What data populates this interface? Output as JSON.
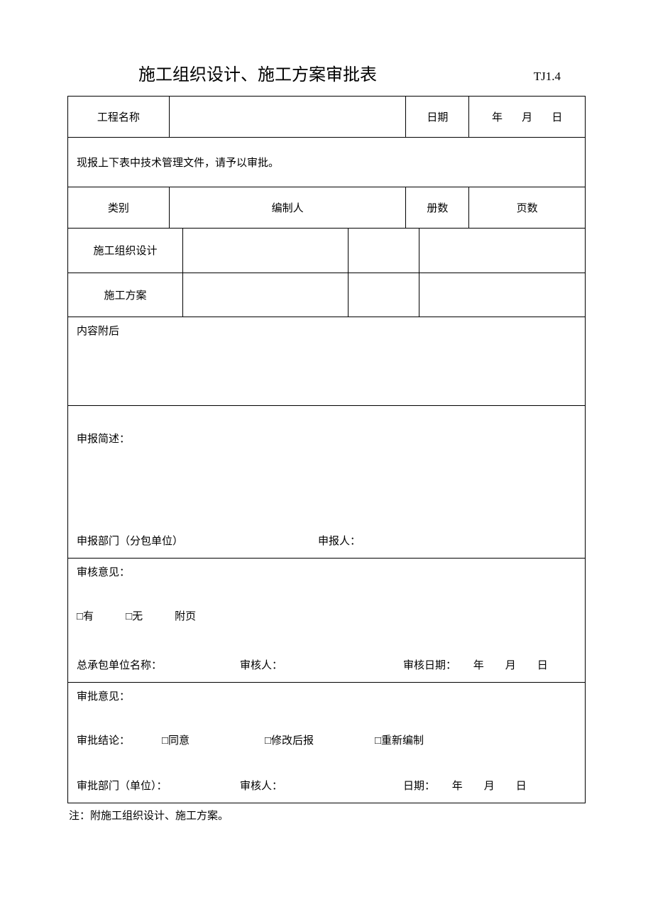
{
  "header": {
    "title": "施工组织设计、施工方案审批表",
    "code": "TJ1.4"
  },
  "row1": {
    "projectNameLabel": "工程名称",
    "dateLabel": "日期",
    "year": "年",
    "month": "月",
    "day": "日"
  },
  "row2": {
    "note": "现报上下表中技术管理文件，请予以审批。"
  },
  "tblHead": {
    "c1": "类别",
    "c2": "编制人",
    "c3": "册数",
    "c4": "页数"
  },
  "tblRows": {
    "r1": "施工组织设计",
    "r2": "施工方案"
  },
  "content": {
    "label": "内容附后"
  },
  "report": {
    "title": "申报简述：",
    "deptLabel": "申报部门（分包单位）",
    "personLabel": "申报人："
  },
  "review": {
    "title": "审核意见：",
    "chkYes": "□有",
    "chkNo": "□无",
    "attach": "附页",
    "unitLabel": "总承包单位名称：",
    "personLabel": "审核人：",
    "dateLabel": "审核日期：",
    "y": "年",
    "m": "月",
    "d": "日"
  },
  "approve": {
    "title": "审批意见：",
    "concLabel": "审批结论：",
    "opt1": "□同意",
    "opt2": "□修改后报",
    "opt3": "□重新编制",
    "deptLabel": "审批部门（单位）：",
    "personLabel": "审核人：",
    "dateLabel": "日期：",
    "y": "年",
    "m": "月",
    "d": "日"
  },
  "footnote": "注：附施工组织设计、施工方案。"
}
